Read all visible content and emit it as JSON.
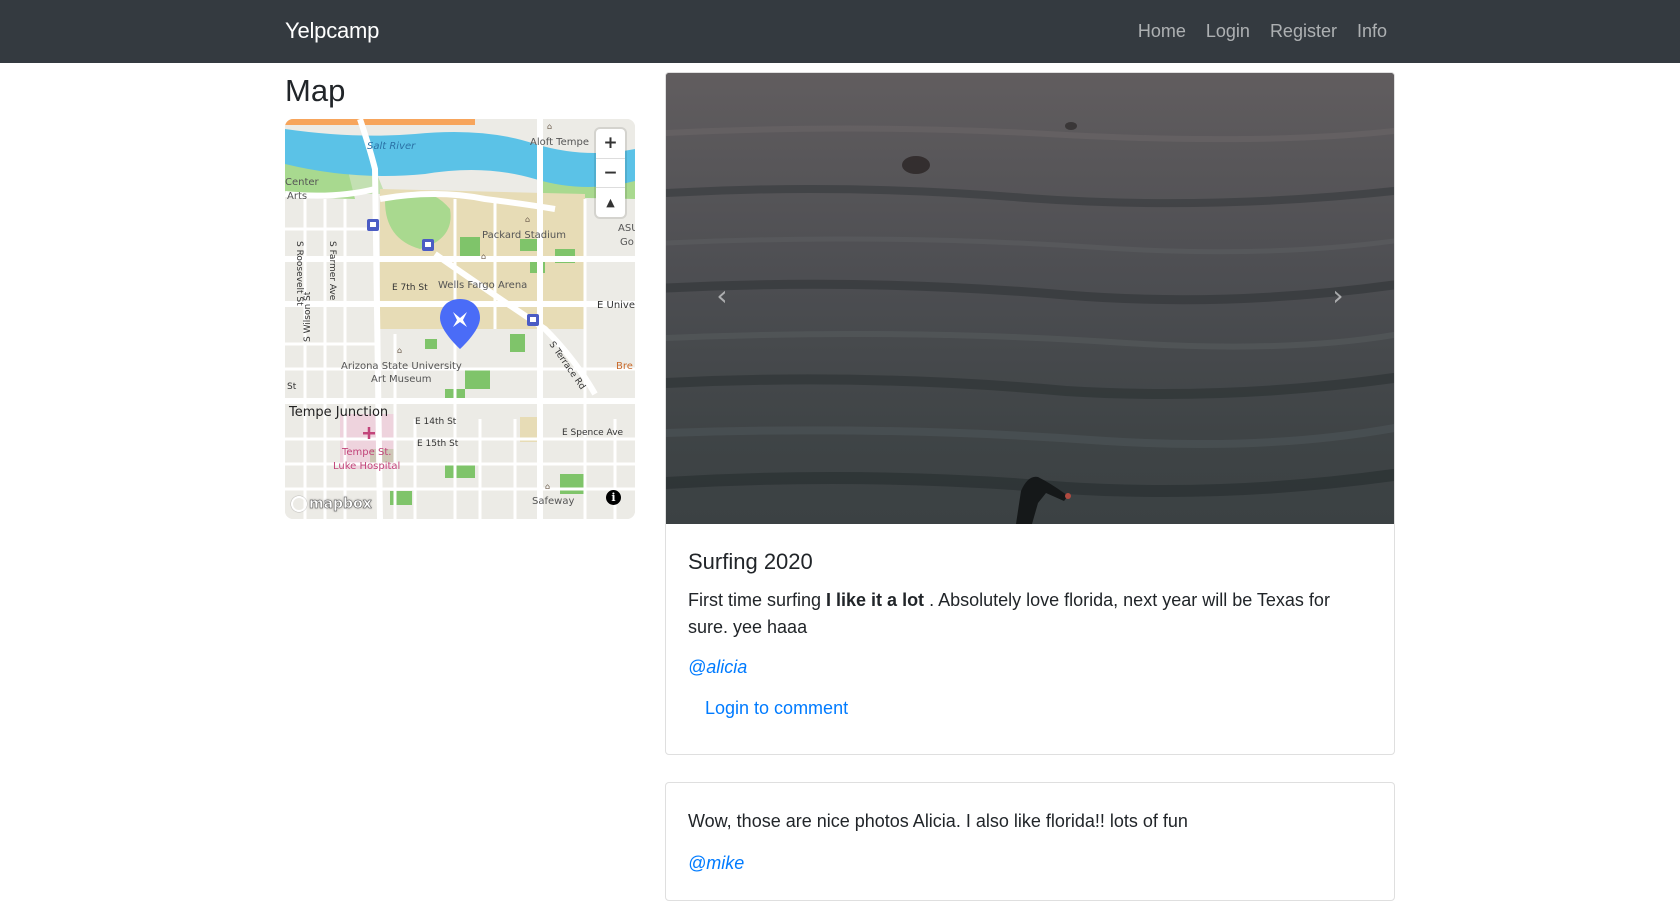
{
  "nav": {
    "brand": "Yelpcamp",
    "links": [
      "Home",
      "Login",
      "Register",
      "Info"
    ]
  },
  "map": {
    "title": "Map",
    "zoom_in": "+",
    "zoom_out": "−",
    "compass": "▲",
    "attribution_logo": "mapbox",
    "info": "i",
    "labels": {
      "river": "Salt River",
      "aloft": "Aloft Tempe",
      "center_arts_1": "Center",
      "center_arts_2": "Arts",
      "asu_1": "ASU",
      "asu_2": "Go",
      "stadium": "Packard Stadium",
      "e7th": "E 7th St",
      "arena": "Wells Fargo Arena",
      "e_univ": "E Unive",
      "roosevelt": "S Roosevelt St",
      "farmer": "S Farmer Ave",
      "wilson": "S Wilson St",
      "terrace": "S Terrace Rd",
      "museum_1": "Arizona State University",
      "museum_2": "Art Museum",
      "bre": "Bre",
      "st": "St",
      "junction": "Tempe Junction",
      "e14th": "E 14th St",
      "e15th": "E 15th St",
      "spence": "E Spence Ave",
      "hospital_1": "Tempe St.",
      "hospital_2": "Luke Hospital",
      "safeway": "Safeway"
    },
    "colors": {
      "water": "#5bc2e7",
      "park": "#a9d98f",
      "campus": "#e7dcb6",
      "land": "#ecebe6",
      "marker": "#4a6cf7"
    }
  },
  "post": {
    "prev_icon": "‹",
    "next_icon": "›",
    "title": "Surfing 2020",
    "text_before": "First time surfing ",
    "text_bold": "I like it a lot",
    "text_after": " . Absolutely love florida, next year will be Texas for sure. yee haaa",
    "author": "@alicia",
    "comment_link": "Login to comment"
  },
  "comments": [
    {
      "text": "Wow, those are nice photos Alicia. I also like florida!! lots of fun",
      "author": "@mike"
    }
  ]
}
